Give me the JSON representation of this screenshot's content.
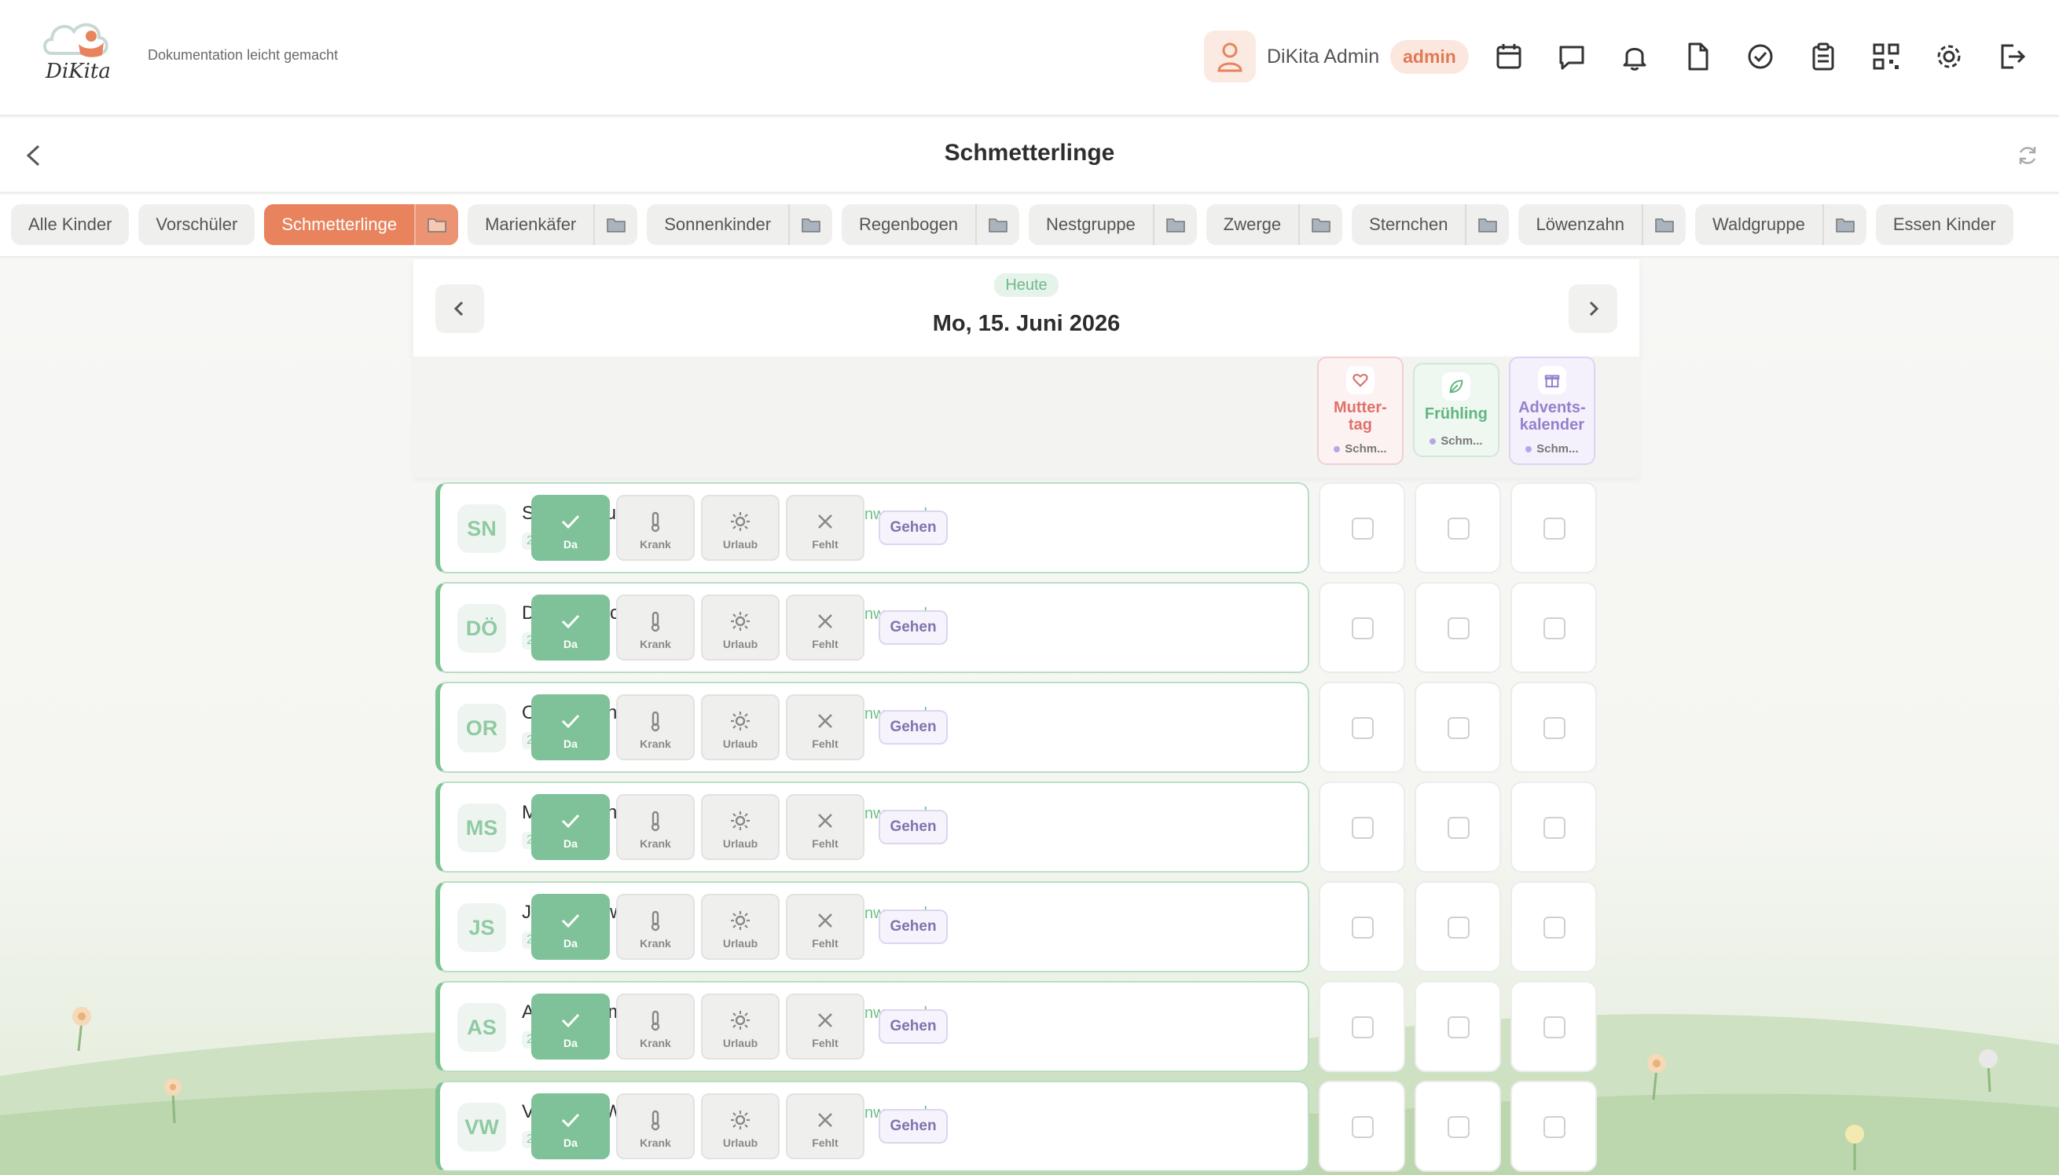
{
  "header": {
    "logo_text": "DiKita",
    "tagline": "Dokumentation leicht gemacht",
    "user_name": "DiKita Admin",
    "role": "admin",
    "icons": [
      "calendar-icon",
      "chat-icon",
      "bell-icon",
      "document-icon",
      "check-circle-icon",
      "clipboard-icon",
      "qr-code-icon",
      "settings-icon",
      "logout-icon"
    ],
    "accent": "#e8835e"
  },
  "page": {
    "title": "Schmetterlinge"
  },
  "tabs": [
    {
      "label": "Alle Kinder",
      "folder": false,
      "active": false
    },
    {
      "label": "Vorschüler",
      "folder": false,
      "active": false
    },
    {
      "label": "Schmetterlinge",
      "folder": true,
      "active": true
    },
    {
      "label": "Marienkäfer",
      "folder": true,
      "active": false
    },
    {
      "label": "Sonnenkinder",
      "folder": true,
      "active": false
    },
    {
      "label": "Regenbogen",
      "folder": true,
      "active": false
    },
    {
      "label": "Nestgruppe",
      "folder": true,
      "active": false
    },
    {
      "label": "Zwerge",
      "folder": true,
      "active": false
    },
    {
      "label": "Sternchen",
      "folder": true,
      "active": false
    },
    {
      "label": "Löwenzahn",
      "folder": true,
      "active": false
    },
    {
      "label": "Waldgruppe",
      "folder": true,
      "active": false
    },
    {
      "label": "Essen Kinder",
      "folder": false,
      "active": false
    }
  ],
  "date": {
    "today_label": "Heute",
    "date_text": "Mo, 15. Juni 2026"
  },
  "events": [
    {
      "name": "Mutter-\ntag",
      "group": "Schm...",
      "icon": "heart-icon",
      "color": "#e0716b",
      "bg": "#fdf2f2",
      "border": "#f3cfcf",
      "dot": "#b9a6e6"
    },
    {
      "name": "Frühling",
      "group": "Schm...",
      "icon": "leaf-icon",
      "color": "#62b582",
      "bg": "#eef8f1",
      "border": "#cfe9d7",
      "dot": "#b9a6e6"
    },
    {
      "name": "Advents-\nkalender",
      "group": "Schm...",
      "icon": "gift-icon",
      "color": "#9580cc",
      "bg": "#f5f1fc",
      "border": "#ddd3f2",
      "dot": "#b9a6e6"
    }
  ],
  "attendance": {
    "status_label": "✓ Anwesend",
    "go_label": "Gehen",
    "actions": [
      {
        "label": "Da",
        "icon": "check-icon"
      },
      {
        "label": "Krank",
        "icon": "thermometer-icon"
      },
      {
        "label": "Urlaub",
        "icon": "sun-icon"
      },
      {
        "label": "Fehlt",
        "icon": "x-icon"
      }
    ]
  },
  "children": [
    {
      "initials": "SN",
      "name": "Stefan Neumann",
      "time": "22:23",
      "badge": {
        "type": "u3",
        "text": "U3",
        "icon": "baby-emoji-icon"
      }
    },
    {
      "initials": "DÖ",
      "name": "Dion Öcekci",
      "time": "22:21",
      "badge": null
    },
    {
      "initials": "OR",
      "name": "Oskar Roth",
      "time": "22:23",
      "badge": null
    },
    {
      "initials": "MS",
      "name": "Maria Schneider",
      "time": "22:23",
      "badge": {
        "type": "music",
        "text": "",
        "icon": "music-note-icon"
      }
    },
    {
      "initials": "JS",
      "name": "Jakob Schwarz",
      "time": "22:23",
      "badge": null
    },
    {
      "initials": "AS",
      "name": "Annika Sommer",
      "time": "22:23",
      "badge": null
    },
    {
      "initials": "VW",
      "name": "Valentina Wagner",
      "time": "22:23",
      "badge": null
    }
  ]
}
